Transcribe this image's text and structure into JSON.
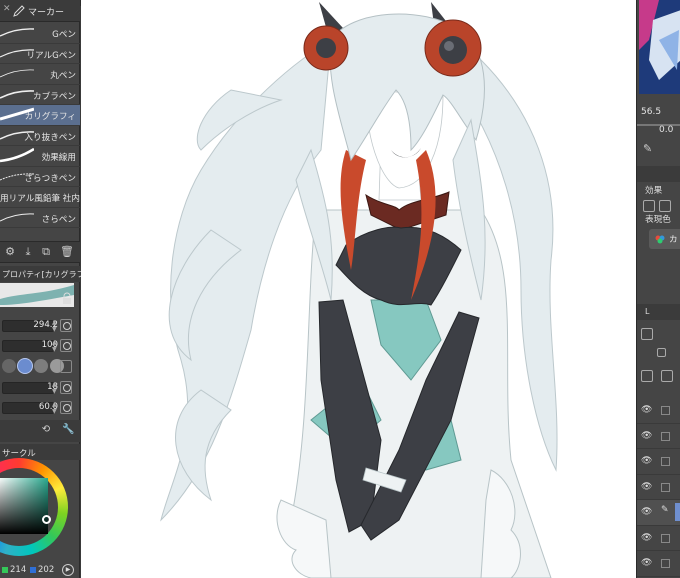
{
  "toolbar": {
    "title": "マーカー"
  },
  "brushes": [
    {
      "label": "Gペン",
      "selected": false
    },
    {
      "label": "リアルGペン",
      "selected": false
    },
    {
      "label": "丸ペン",
      "selected": false
    },
    {
      "label": "カブラペン",
      "selected": false
    },
    {
      "label": "カリグラフィ",
      "selected": true
    },
    {
      "label": "入り抜きペン",
      "selected": false
    },
    {
      "label": "効果線用",
      "selected": false
    },
    {
      "label": "ざらつきペン",
      "selected": false
    },
    {
      "label": "用リアル風鉛筆 社内",
      "selected": false
    },
    {
      "label": "さらペン",
      "selected": false
    }
  ],
  "properties": {
    "header": "プロパティ[カリグラフ",
    "brush_size": "294.2",
    "opacity": "100",
    "tip_angle": "18",
    "thickness": "60.0"
  },
  "color": {
    "header": "サークル",
    "green": "214",
    "blue": "202",
    "accent": "#2aa98f"
  },
  "right_panel": {
    "zoom": "56.5",
    "angle": "0.0",
    "effect_label": "効果",
    "expression_label": "表現色",
    "expression_value": "カ",
    "layer_label": "L"
  },
  "colors": {
    "selection": "#5b6f8f",
    "panel": "#454545",
    "hair": "#dfe9ec",
    "hair_red": "#c94a2c",
    "dress_teal": "#86c8c0",
    "glove": "#3d3f45"
  }
}
